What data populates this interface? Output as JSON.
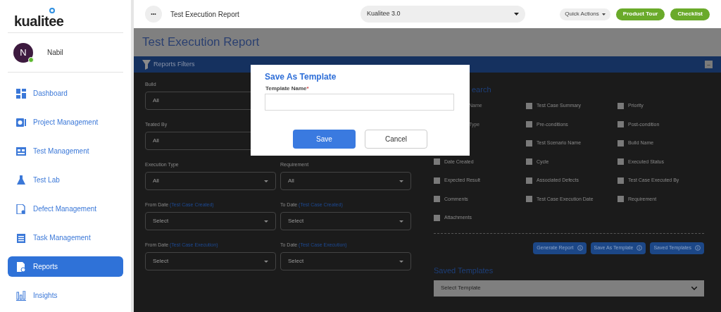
{
  "sidebar": {
    "logo": "kualitee",
    "user": {
      "initial": "N",
      "name": "Nabil",
      "online": true
    },
    "items": [
      {
        "label": "Dashboard",
        "selected": false
      },
      {
        "label": "Project Management",
        "selected": false
      },
      {
        "label": "Test Management",
        "selected": false
      },
      {
        "label": "Test Lab",
        "selected": false
      },
      {
        "label": "Defect Management",
        "selected": false
      },
      {
        "label": "Task Management",
        "selected": false
      },
      {
        "label": "Reports",
        "selected": true
      },
      {
        "label": "Insights",
        "selected": false
      }
    ]
  },
  "header": {
    "menu_glyph": "•••",
    "title": "Test Execution Report",
    "project": "Kualitee 3.0",
    "quick_actions": "Quick Actions",
    "buttons": [
      "Product Tour",
      "Checklist"
    ]
  },
  "page_title": "Test Execution Report",
  "filters": {
    "title": "Reports Filters",
    "collapse_glyph": "–",
    "fields": [
      {
        "label": "Build",
        "value": "All",
        "kind": "wide"
      },
      {
        "label": "Teated By",
        "value": "All",
        "kind": "wide"
      },
      {
        "label": "Execution Type",
        "value": "All",
        "kind": "half"
      },
      {
        "label": "Requirement",
        "value": "All",
        "kind": "half"
      },
      {
        "label": "From Date",
        "note": "(Test Case Created)",
        "value": "Select",
        "kind": "half"
      },
      {
        "label": "To Date",
        "note": "(Test Case Created)",
        "value": "Select",
        "kind": "half"
      },
      {
        "label": "From Date",
        "note": "(Test Case Execution)",
        "value": "Select",
        "kind": "half"
      },
      {
        "label": "To Date",
        "note": "(Test Case Execution)",
        "value": "Select",
        "kind": "half"
      }
    ]
  },
  "quick_search": {
    "heading": "earch",
    "columns": [
      [
        {
          "label": "Name",
          "kind": "cut"
        },
        {
          "label": "Type",
          "kind": "cut"
        },
        {
          "kind": "gap"
        },
        {
          "label": "Date Created",
          "kind": "box",
          "checked": false
        },
        {
          "label": "Expected Result",
          "kind": "box",
          "checked": false
        },
        {
          "label": "Comments",
          "kind": "box",
          "checked": false
        },
        {
          "label": "Attachments",
          "kind": "box",
          "checked": false
        }
      ],
      [
        {
          "label": "Test Case Summary",
          "kind": "box",
          "checked": false
        },
        {
          "label": "Pre-conditions",
          "kind": "box",
          "checked": false
        },
        {
          "label": "Test Scenario Name",
          "kind": "box",
          "checked": false
        },
        {
          "label": "Cycle",
          "kind": "box",
          "checked": false
        },
        {
          "label": "Associated Defects",
          "kind": "box",
          "checked": false
        },
        {
          "label": "Test Case Execution Date",
          "kind": "box",
          "checked": false
        }
      ],
      [
        {
          "label": "Priority",
          "kind": "box",
          "checked": false
        },
        {
          "label": "Post-condition",
          "kind": "box",
          "checked": false
        },
        {
          "label": "Build Name",
          "kind": "box",
          "checked": false
        },
        {
          "label": "Executed Status",
          "kind": "box",
          "checked": false
        },
        {
          "label": "Test Case Executed By",
          "kind": "box",
          "checked": false
        },
        {
          "label": "Requirement",
          "kind": "box",
          "checked": false
        }
      ]
    ],
    "actions": [
      "Generate Report",
      "Save As Template",
      "Saved Templates"
    ],
    "saved_heading": "Saved Templates",
    "template_select": "Select Template"
  },
  "dialog": {
    "title": "Save As Template",
    "field_label": "Template Name",
    "required_mark": "*",
    "buttons": [
      {
        "label": "Save",
        "kind": "primary"
      },
      {
        "label": "Cancel",
        "kind": "secondary"
      }
    ]
  }
}
